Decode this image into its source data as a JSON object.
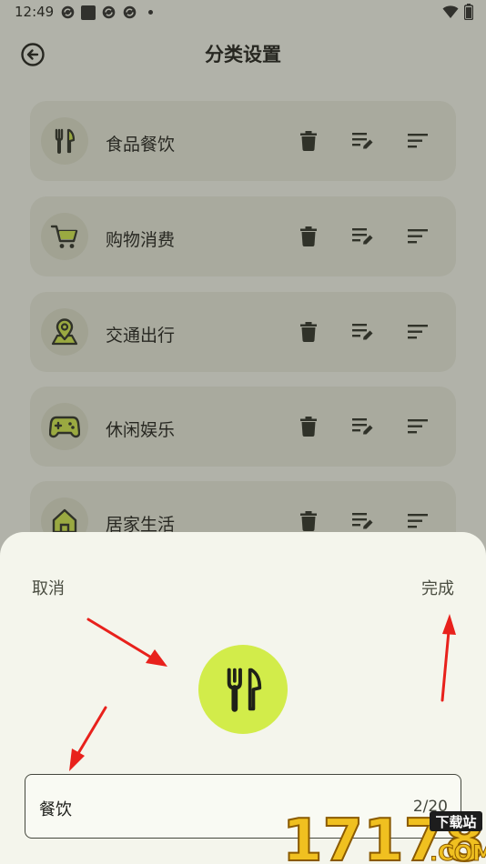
{
  "status_bar": {
    "time": "12:49",
    "icons": [
      "sync-icon",
      "stop-square-icon",
      "sync-icon",
      "sync-icon",
      "dot-icon"
    ],
    "right_icons": [
      "wifi-icon",
      "battery-icon"
    ]
  },
  "header": {
    "back_icon": "back-arrow-icon",
    "title": "分类设置"
  },
  "categories": [
    {
      "label": "食品餐饮",
      "icon": "fork-knife-icon"
    },
    {
      "label": "购物消费",
      "icon": "cart-icon"
    },
    {
      "label": "交通出行",
      "icon": "location-pin-icon"
    },
    {
      "label": "休闲娱乐",
      "icon": "gamepad-icon"
    },
    {
      "label": "居家生活",
      "icon": "home-icon"
    }
  ],
  "category_actions": [
    "trash-icon",
    "edit-list-icon",
    "sort-icon"
  ],
  "sheet": {
    "cancel_label": "取消",
    "done_label": "完成",
    "selected_icon": "fork-knife-icon",
    "name_value": "餐饮",
    "name_counter": "2/20"
  },
  "watermark": {
    "text": "17178",
    "badge": "下载站",
    "suffix": ".COM"
  },
  "colors": {
    "accent": "#d2ec4a",
    "card": "#e6e8dc",
    "sheet": "#f4f5ec",
    "arrow": "#e8211c",
    "icon_dark": "#2a2c24"
  }
}
